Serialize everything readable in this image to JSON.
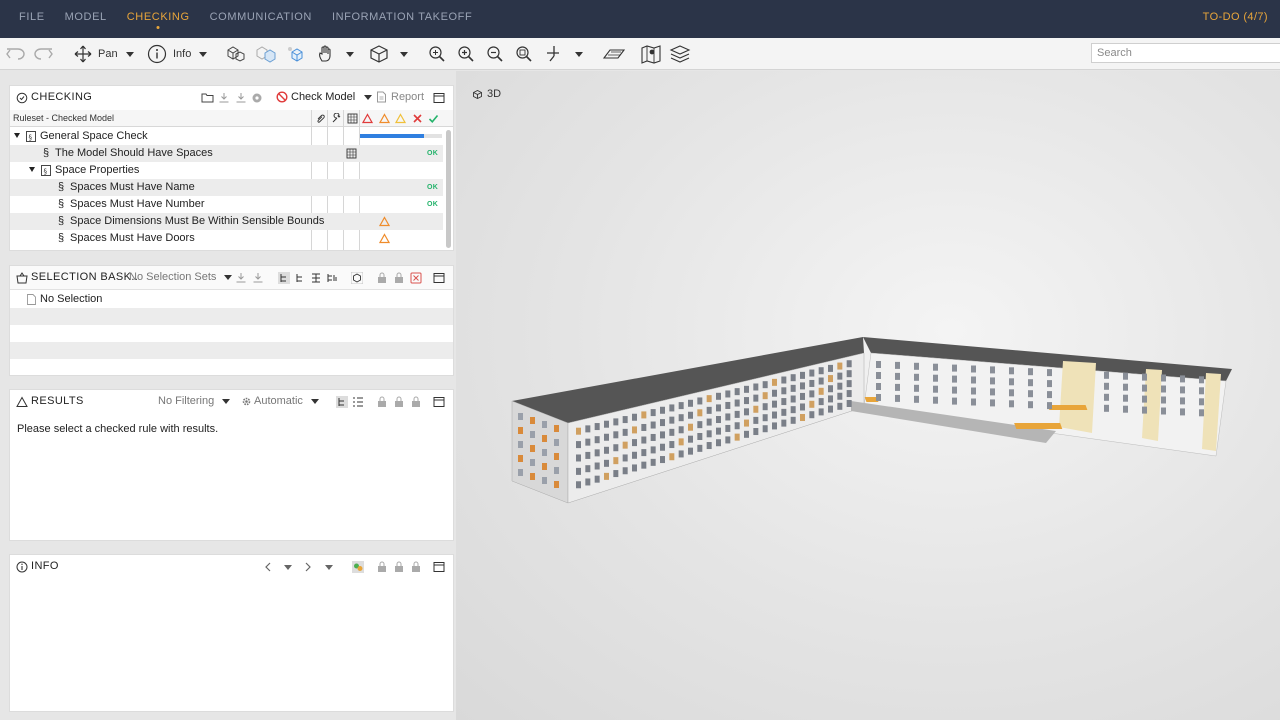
{
  "menu": {
    "tabs": [
      {
        "label": "FILE"
      },
      {
        "label": "MODEL"
      },
      {
        "label": "CHECKING"
      },
      {
        "label": "COMMUNICATION"
      },
      {
        "label": "INFORMATION TAKEOFF"
      }
    ],
    "active_tab": "CHECKING",
    "todo": "TO-DO (4/7)"
  },
  "toolbar": {
    "pan_label": "Pan",
    "info_label": "Info",
    "search_placeholder": "Search"
  },
  "checking": {
    "title": "CHECKING",
    "check_model_label": "Check Model",
    "report_label": "Report",
    "ruleset_label": "Ruleset - Checked Model",
    "rows": [
      {
        "label": "General Space Check",
        "status": "progress"
      },
      {
        "label": "The Model Should Have Spaces",
        "status": "OK"
      },
      {
        "label": "Space Properties",
        "status": ""
      },
      {
        "label": "Spaces Must Have Name",
        "status": "OK"
      },
      {
        "label": "Spaces Must Have Number",
        "status": "OK"
      },
      {
        "label": "Space Dimensions Must Be Within Sensible Bounds",
        "status": "warning"
      },
      {
        "label": "Spaces Must Have Doors",
        "status": "warning"
      }
    ],
    "progress_fraction": 0.78
  },
  "selection_basket": {
    "title": "SELECTION BASK..",
    "sets_label": "No Selection Sets",
    "empty_label": "No Selection"
  },
  "results": {
    "title": "RESULTS",
    "filter_label": "No Filtering",
    "mode_label": "Automatic",
    "message": "Please select a checked rule with results."
  },
  "info": {
    "title": "INFO"
  },
  "view": {
    "label": "3D"
  },
  "colors": {
    "menubar_bg": "#2b3448",
    "accent": "#e8a53a",
    "ok_green": "#24b36b",
    "warning_orange": "#ef8c2b",
    "error_red": "#e03b3b",
    "progress_blue": "#2f7fe0"
  }
}
